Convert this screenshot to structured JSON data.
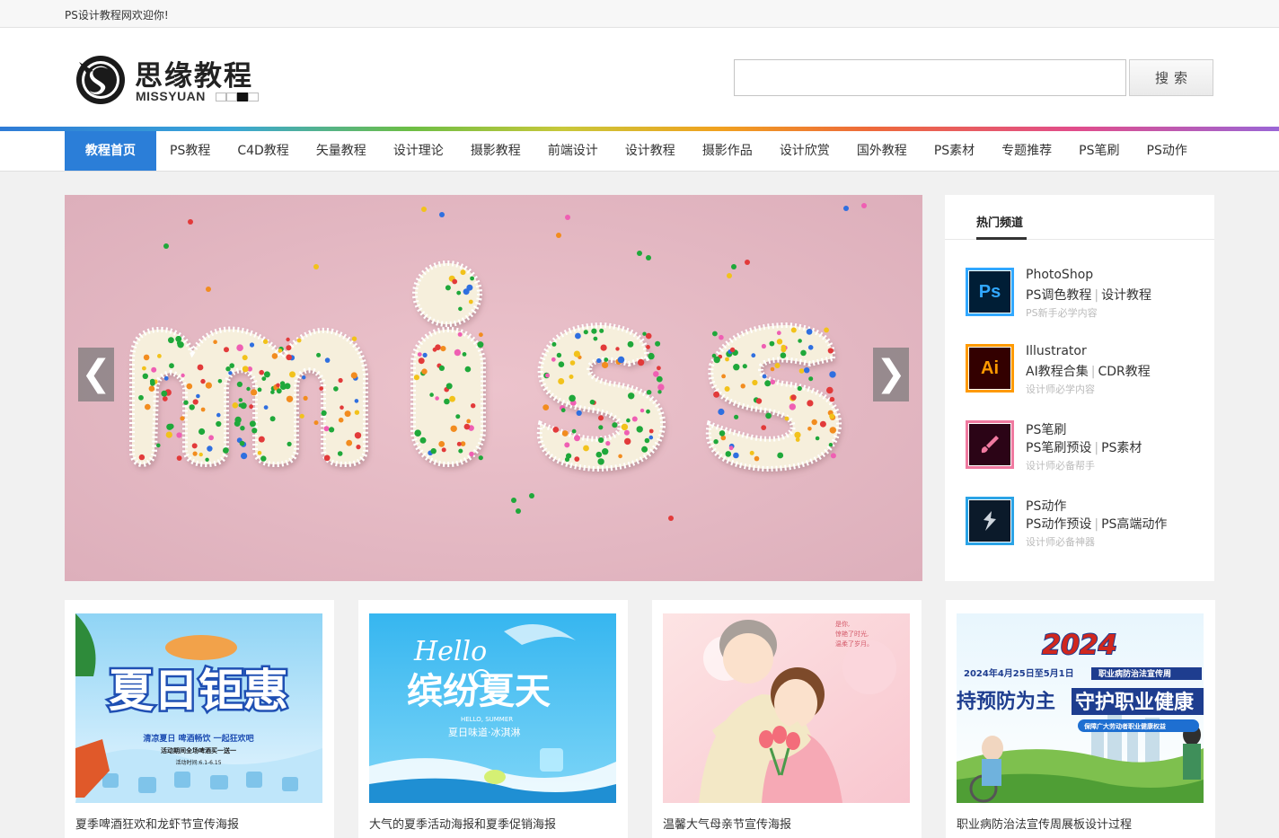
{
  "topbar": {
    "welcome": "PS设计教程网欢迎你!"
  },
  "logo": {
    "cn": "思缘教程",
    "en": "MISSYUAN"
  },
  "search": {
    "value": "",
    "placeholder": "",
    "button": "搜索"
  },
  "nav": {
    "items": [
      "教程首页",
      "PS教程",
      "C4D教程",
      "矢量教程",
      "设计理论",
      "摄影教程",
      "前端设计",
      "设计教程",
      "摄影作品",
      "设计欣赏",
      "国外教程",
      "PS素材",
      "专题推荐",
      "PS笔刷",
      "PS动作"
    ],
    "active": "教程首页"
  },
  "banner": {
    "prev": "❮",
    "next": "❯"
  },
  "hot": {
    "title": "热门频道",
    "channels": [
      {
        "name": "PhotoShop",
        "link1": "PS调色教程",
        "link2": "设计教程",
        "sub": "PS新手必学内容",
        "icon": "photoshop-icon",
        "icon_text": "Ps",
        "color": "#31a8ff",
        "bg": "#001e36"
      },
      {
        "name": "Illustrator",
        "link1": "AI教程合集",
        "link2": "CDR教程",
        "sub": "设计师必学内容",
        "icon": "illustrator-icon",
        "icon_text": "Ai",
        "color": "#ff9a00",
        "bg": "#330000"
      },
      {
        "name": "PS笔刷",
        "link1": "PS笔刷预设",
        "link2": "PS素材",
        "sub": "设计师必备帮手",
        "icon": "brush-icon",
        "icon_text": "",
        "color": "#f07aa0",
        "bg": "#2b0416"
      },
      {
        "name": "PS动作",
        "link1": "PS动作预设",
        "link2": "PS高端动作",
        "sub": "设计师必备神器",
        "icon": "action-icon",
        "icon_text": "",
        "color": "#2aa3e6",
        "bg": "#0b1a2a"
      }
    ]
  },
  "cards": [
    {
      "caption": "夏季啤酒狂欢和龙虾节宣传海报",
      "thumb": {
        "headline": "夏日钜惠",
        "line1": "清凉夏日 啤酒畅饮 一起狂欢吧",
        "line2": "活动期间全场啤酒买一送一",
        "line3": "活动时间:6.1-6.15"
      }
    },
    {
      "caption": "大气的夏季活动海报和夏季促销海报",
      "thumb": {
        "script": "Hello",
        "headline": "缤纷夏天",
        "en": "HELLO, SUMMER",
        "line1": "夏日味道·冰淇淋"
      }
    },
    {
      "caption": "温馨大气母亲节宣传海报",
      "thumb": {
        "poem1": "是你,",
        "poem2": "惊艳了时光,",
        "poem3": "温柔了岁月。"
      }
    },
    {
      "caption": "职业病防治法宣传周展板设计过程",
      "thumb": {
        "year": "2024",
        "line1": "2024年4月25日至5月1日",
        "line1b": "职业病防治法宣传周",
        "headline1": "持预防为主",
        "headline2": "守护职业健康",
        "ribbon": "保障广大劳动者职业健康权益"
      }
    }
  ]
}
